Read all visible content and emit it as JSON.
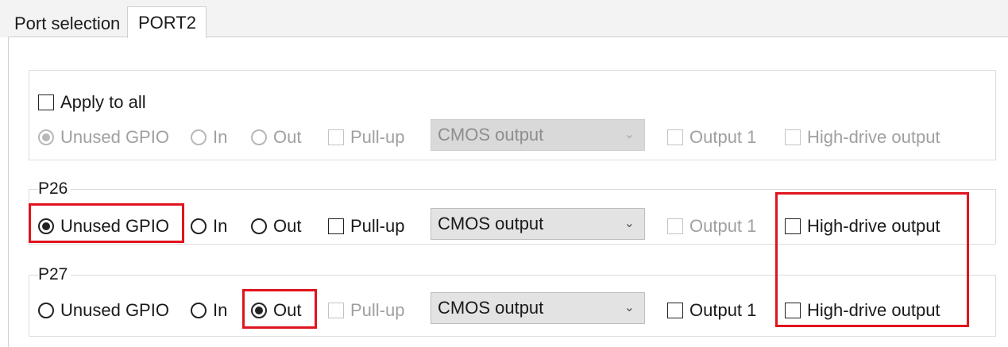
{
  "tabs": [
    {
      "label": "Port selection",
      "active": false
    },
    {
      "label": "PORT2",
      "active": true
    }
  ],
  "apply_all": {
    "checkbox_label": "Apply to all",
    "row": {
      "unused": "Unused GPIO",
      "in": "In",
      "out": "Out",
      "pullup": "Pull-up",
      "select_value": "CMOS output",
      "output1": "Output 1",
      "high_drive": "High-drive output"
    }
  },
  "ports": [
    {
      "name": "P26",
      "unused": "Unused GPIO",
      "in": "In",
      "out": "Out",
      "pullup": "Pull-up",
      "select_value": "CMOS output",
      "output1": "Output 1",
      "high_drive": "High-drive output",
      "selected": "unused"
    },
    {
      "name": "P27",
      "unused": "Unused GPIO",
      "in": "In",
      "out": "Out",
      "pullup": "Pull-up",
      "select_value": "CMOS output",
      "output1": "Output 1",
      "high_drive": "High-drive output",
      "selected": "out"
    }
  ],
  "icons": {
    "chevron": "chevron-down-icon"
  },
  "colors": {
    "highlight": "#e0141e"
  }
}
